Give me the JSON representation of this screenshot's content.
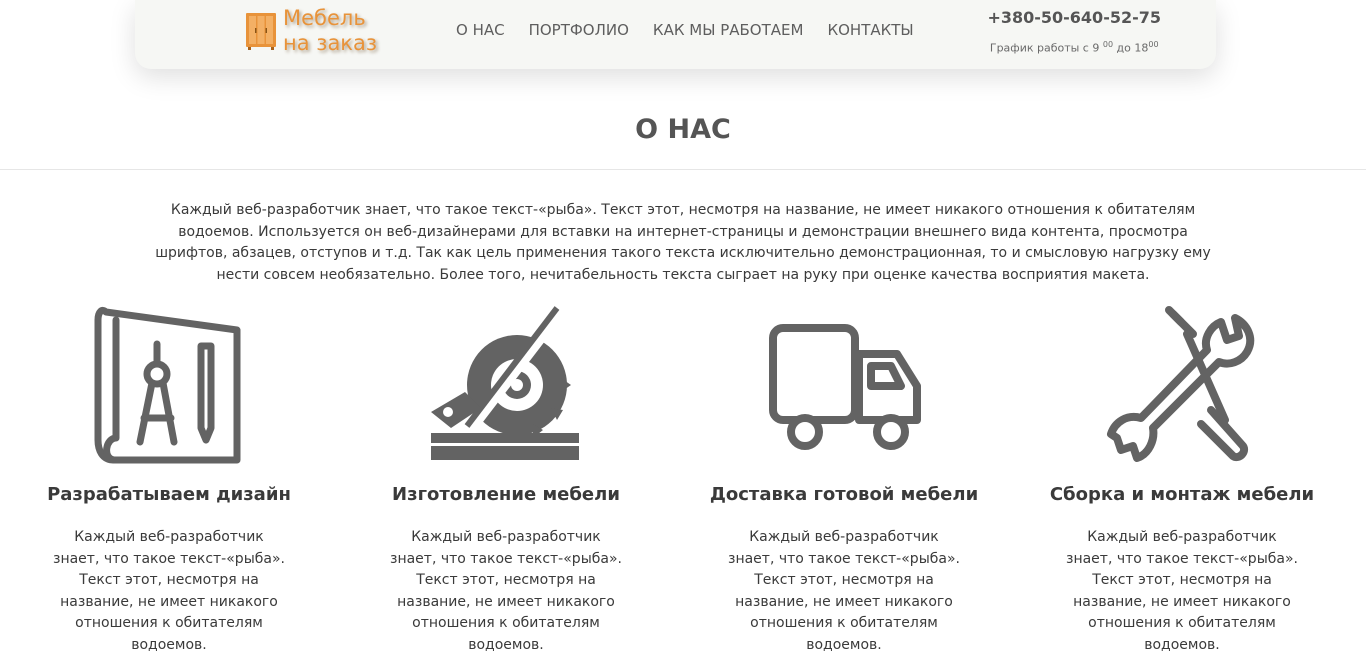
{
  "header": {
    "logo": {
      "line1": "Мебель",
      "line2": "на заказ",
      "icon": "wardrobe-icon"
    },
    "nav": [
      "О НАС",
      "ПОРТФОЛИО",
      "КАК МЫ РАБОТАЕМ",
      "КОНТАКТЫ"
    ],
    "phone": "+380-50-640-52-75",
    "hours": {
      "prefix": "График работы с 9",
      "sup1": "00",
      "mid": " до 18",
      "sup2": "00"
    }
  },
  "section": {
    "title": "О НАС",
    "intro": "Каждый веб-разработчик знает, что такое текст-«рыба». Текст этот, несмотря на название, не имеет никакого отношения к обитателям водоемов. Используется он веб-дизайнерами для вставки на интернет-страницы и демонстрации внешнего вида контента, просмотра шрифтов, абзацев, отступов и т.д. Так как цель применения такого текста исключительно демонстрационная, то и смысловую нагрузку ему нести совсем необязательно. Более того, нечитабельность текста сыграет на руку при оценке качества восприятия макета."
  },
  "features": [
    {
      "icon": "blueprint-icon",
      "title": "Разрабатываем дизайн",
      "text": "Каждый веб-разработчик знает, что такое текст-«рыба». Текст этот, несмотря на название, не имеет никакого отношения к обитателям водоемов."
    },
    {
      "icon": "circular-saw-icon",
      "title": "Изготовление мебели",
      "text": "Каждый веб-разработчик знает, что такое текст-«рыба». Текст этот, несмотря на название, не имеет никакого отношения к обитателям водоемов."
    },
    {
      "icon": "delivery-truck-icon",
      "title": "Доставка готовой мебели",
      "text": "Каждый веб-разработчик знает, что такое текст-«рыба». Текст этот, несмотря на название, не имеет никакого отношения к обитателям водоемов."
    },
    {
      "icon": "tools-icon",
      "title": "Сборка и монтаж мебели",
      "text": "Каждый веб-разработчик знает, что такое текст-«рыба». Текст этот, несмотря на название, не имеет никакого отношения к обитателям водоемов."
    }
  ],
  "colors": {
    "accent": "#e8933a",
    "icon": "#636363",
    "header_bg": "#f6f7f4"
  }
}
